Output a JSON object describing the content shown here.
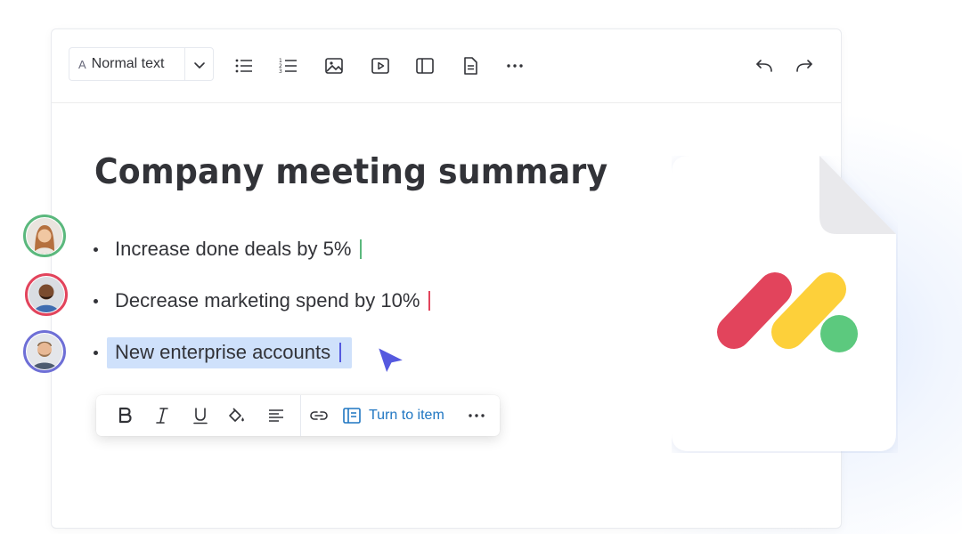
{
  "toolbar": {
    "text_style": {
      "prefix": "A",
      "value": "Normal text"
    },
    "icons": [
      "bulleted-list-icon",
      "numbered-list-icon",
      "image-icon",
      "video-icon",
      "layout-icon",
      "document-icon",
      "more-icon",
      "undo-icon",
      "redo-icon"
    ]
  },
  "document": {
    "title": "Company meeting summary",
    "bullets": [
      {
        "text": "Increase done deals by 5%",
        "caret_color": "#5bb87d",
        "avatar_border": "#5bb87d",
        "selected": false
      },
      {
        "text": "Decrease marketing spend by 10%",
        "caret_color": "#e2445c",
        "avatar_border": "#e2445c",
        "selected": false
      },
      {
        "text": "New enterprise accounts",
        "caret_color": "#5559df",
        "avatar_border": "#6e6fd6",
        "selected": true
      }
    ]
  },
  "format_toolbar": {
    "items": [
      "bold-icon",
      "italic-icon",
      "underline-icon",
      "text-color-icon",
      "align-icon",
      "link-icon"
    ],
    "turn_to_item_label": "Turn to item"
  },
  "brand_colors": {
    "red": "#e2445c",
    "yellow": "#fdd03a",
    "green": "#5cc97e",
    "selection": "#cfe1fb",
    "link": "#1f76c2"
  }
}
